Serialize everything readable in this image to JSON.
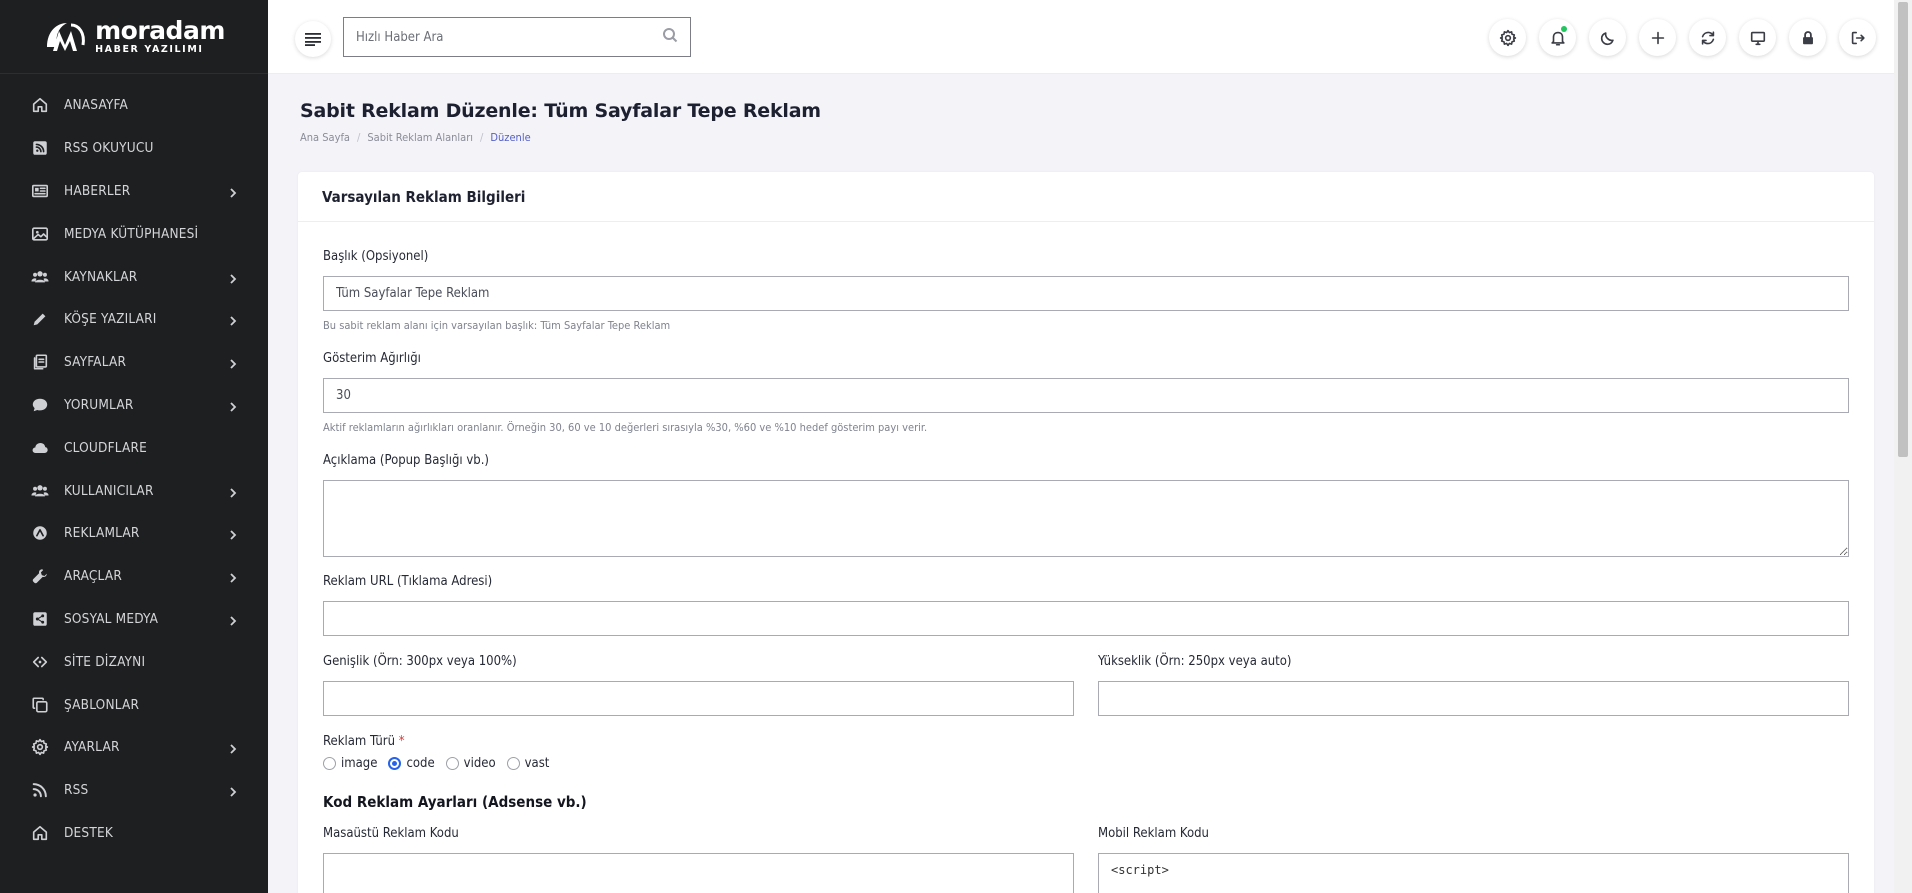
{
  "brand": {
    "name": "moradam",
    "tagline": "HABER YAZILIMI"
  },
  "search": {
    "placeholder": "Hızlı Haber Ara"
  },
  "sidebar": {
    "items": [
      {
        "label": "ANASAYFA",
        "icon": "home-icon"
      },
      {
        "label": "RSS OKUYUCU",
        "icon": "rss-square-icon"
      },
      {
        "label": "HABERLER",
        "icon": "newspaper-icon"
      },
      {
        "label": "MEDYA KÜTÜPHANESİ",
        "icon": "image-icon"
      },
      {
        "label": "KAYNAKLAR",
        "icon": "users-icon"
      },
      {
        "label": "KÖŞE YAZILARI",
        "icon": "pen-icon"
      },
      {
        "label": "SAYFALAR",
        "icon": "pages-icon"
      },
      {
        "label": "YORUMLAR",
        "icon": "comment-icon"
      },
      {
        "label": "CLOUDFLARE",
        "icon": "cloud-icon"
      },
      {
        "label": "KULLANICILAR",
        "icon": "users-icon"
      },
      {
        "label": "REKLAMLAR",
        "icon": "ad-icon"
      },
      {
        "label": "ARAÇLAR",
        "icon": "wrench-icon"
      },
      {
        "label": "SOSYAL MEDYA",
        "icon": "share-icon"
      },
      {
        "label": "SİTE DİZAYNI",
        "icon": "design-icon"
      },
      {
        "label": "ŞABLONLAR",
        "icon": "copy-icon"
      },
      {
        "label": "AYARLAR",
        "icon": "gear-icon"
      },
      {
        "label": "RSS",
        "icon": "rss-icon"
      },
      {
        "label": "DESTEK",
        "icon": "home-icon"
      }
    ]
  },
  "page": {
    "title": "Sabit Reklam Düzenle: Tüm Sayfalar Tepe Reklam",
    "breadcrumb": [
      "Ana Sayfa",
      "Sabit Reklam Alanları",
      "Düzenle"
    ]
  },
  "form": {
    "card_title": "Varsayılan Reklam Bilgileri",
    "title_label": "Başlık (Opsiyonel)",
    "title_value": "Tüm Sayfalar Tepe Reklam",
    "title_help": "Bu sabit reklam alanı için varsayılan başlık: Tüm Sayfalar Tepe Reklam",
    "weight_label": "Gösterim Ağırlığı",
    "weight_value": "30",
    "weight_help": "Aktif reklamların ağırlıkları oranlanır. Örneğin 30, 60 ve 10 değerleri sırasıyla %30, %60 ve %10 hedef gösterim payı verir.",
    "desc_label": "Açıklama (Popup Başlığı vb.)",
    "desc_value": "",
    "url_label": "Reklam URL (Tıklama Adresi)",
    "url_value": "",
    "width_label": "Genişlik (Örn: 300px veya 100%)",
    "width_value": "",
    "height_label": "Yükseklik (Örn: 250px veya auto)",
    "height_value": "",
    "type_label": "Reklam Türü",
    "type_required": "*",
    "type_options": [
      "image",
      "code",
      "video",
      "vast"
    ],
    "type_selected": "code",
    "code_section_title": "Kod Reklam Ayarları (Adsense vb.)",
    "desktop_code_label": "Masaüstü Reklam Kodu",
    "desktop_code_value": "",
    "mobile_code_label": "Mobil Reklam Kodu",
    "mobile_code_value": "<script>"
  }
}
